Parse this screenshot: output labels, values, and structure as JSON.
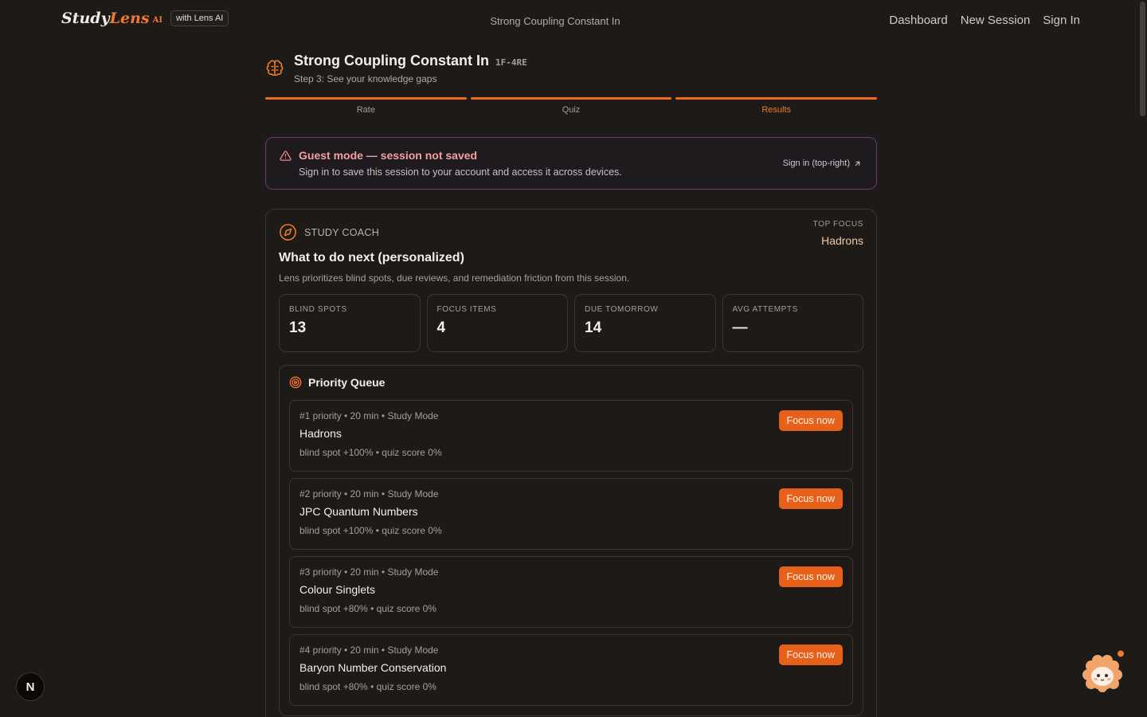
{
  "header": {
    "logo_study": "Study",
    "logo_lens": "Lens",
    "logo_ai": "AI",
    "badge": "with Lens AI",
    "page_title": "Strong Coupling Constant In",
    "nav": [
      "Dashboard",
      "New Session",
      "Sign In"
    ]
  },
  "session": {
    "title": "Strong Coupling Constant In",
    "code": "1F-4RE",
    "subtitle": "Step 3: See your knowledge gaps",
    "steps": [
      {
        "label": "Rate",
        "active": false
      },
      {
        "label": "Quiz",
        "active": false
      },
      {
        "label": "Results",
        "active": true
      }
    ]
  },
  "guest": {
    "title": "Guest mode — session not saved",
    "text": "Sign in to save this session to your account and access it across devices.",
    "link": "Sign in (top-right)"
  },
  "coach": {
    "label": "STUDY COACH",
    "heading": "What to do next (personalized)",
    "description": "Lens prioritizes blind spots, due reviews, and remediation friction from this session.",
    "top_focus_label": "TOP FOCUS",
    "top_focus_value": "Hadrons",
    "stats": [
      {
        "label": "BLIND SPOTS",
        "value": "13"
      },
      {
        "label": "FOCUS ITEMS",
        "value": "4"
      },
      {
        "label": "DUE TOMORROW",
        "value": "14"
      },
      {
        "label": "AVG ATTEMPTS",
        "value": "—"
      }
    ]
  },
  "queue": {
    "title": "Priority Queue",
    "button_label": "Focus now",
    "items": [
      {
        "meta": "#1 priority • 20 min • Study Mode",
        "name": "Hadrons",
        "stats": "blind spot +100% • quiz score 0%"
      },
      {
        "meta": "#2 priority • 20 min • Study Mode",
        "name": "JPC Quantum Numbers",
        "stats": "blind spot +100% • quiz score 0%"
      },
      {
        "meta": "#3 priority • 20 min • Study Mode",
        "name": "Colour Singlets",
        "stats": "blind spot +80% • quiz score 0%"
      },
      {
        "meta": "#4 priority • 20 min • Study Mode",
        "name": "Baryon Number Conservation",
        "stats": "blind spot +80% • quiz score 0%"
      }
    ]
  },
  "widgets": {
    "n_badge": "N"
  },
  "colors": {
    "accent": "#e8611a",
    "background": "#1d1a18",
    "guest_border": "#6a3a75",
    "warning_text": "#f4a0a0"
  },
  "icons": [
    "brain-icon",
    "warning-icon",
    "external-link-icon",
    "compass-icon",
    "target-icon"
  ]
}
